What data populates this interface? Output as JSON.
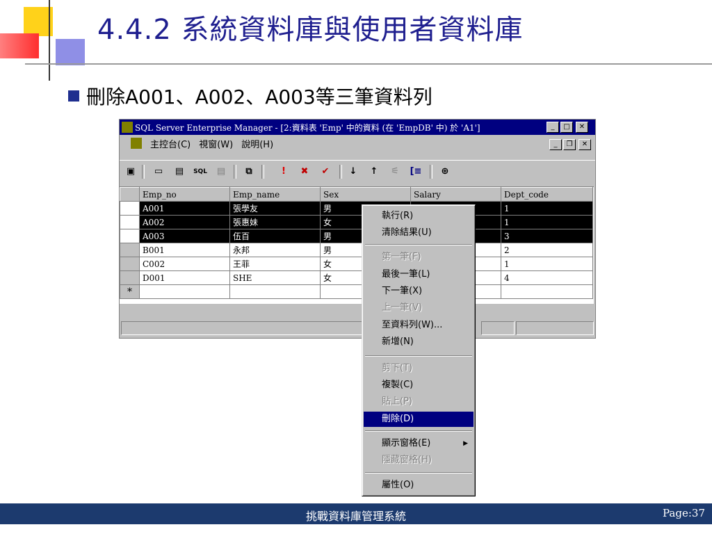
{
  "slide": {
    "title": "4.4.2 系統資料庫與使用者資料庫",
    "bullet": "刪除A001、A002、A003等三筆資料列"
  },
  "window": {
    "title": "SQL Server Enterprise Manager - [2:資料表 'Emp' 中的資料 (在 'EmpDB' 中) 於 'A1']",
    "menu": [
      "主控台(C)",
      "視窗(W)",
      "說明(H)"
    ],
    "grid": {
      "columns": [
        "Emp_no",
        "Emp_name",
        "Sex",
        "Salary",
        "Dept_code"
      ],
      "rows": [
        {
          "emp_no": "A001",
          "emp_name": "張學友",
          "sex": "男",
          "salary": "",
          "dept_code": "1",
          "selected": true
        },
        {
          "emp_no": "A002",
          "emp_name": "張惠妹",
          "sex": "女",
          "salary": "",
          "dept_code": "1",
          "selected": true
        },
        {
          "emp_no": "A003",
          "emp_name": "伍百",
          "sex": "男",
          "salary": "",
          "dept_code": "3",
          "selected": true
        },
        {
          "emp_no": "B001",
          "emp_name": "永邦",
          "sex": "男",
          "salary": "",
          "dept_code": "2",
          "selected": false
        },
        {
          "emp_no": "C002",
          "emp_name": "王菲",
          "sex": "女",
          "salary": "",
          "dept_code": "1",
          "selected": false
        },
        {
          "emp_no": "D001",
          "emp_name": "SHE",
          "sex": "女",
          "salary": "",
          "dept_code": "4",
          "selected": false
        }
      ],
      "new_row_marker": "*"
    }
  },
  "context_menu": {
    "items": [
      {
        "label": "執行(R)",
        "state": "enabled"
      },
      {
        "label": "清除結果(U)",
        "state": "enabled"
      },
      {
        "label": "第一筆(F)",
        "state": "disabled"
      },
      {
        "label": "最後一筆(L)",
        "state": "enabled"
      },
      {
        "label": "下一筆(X)",
        "state": "enabled"
      },
      {
        "label": "上一筆(V)",
        "state": "disabled"
      },
      {
        "label": "至資料列(W)...",
        "state": "enabled"
      },
      {
        "label": "新增(N)",
        "state": "enabled"
      },
      {
        "label": "剪下(T)",
        "state": "disabled"
      },
      {
        "label": "複製(C)",
        "state": "enabled"
      },
      {
        "label": "貼上(P)",
        "state": "disabled"
      },
      {
        "label": "刪除(D)",
        "state": "highlighted"
      },
      {
        "label": "顯示窗格(E)",
        "state": "enabled",
        "submenu": true
      },
      {
        "label": "隱藏窗格(H)",
        "state": "disabled"
      },
      {
        "label": "屬性(O)",
        "state": "enabled"
      }
    ]
  },
  "footer": {
    "center": "挑戰資料庫管理系統",
    "page": "Page:37"
  },
  "colors": {
    "title": "#1f1f8f",
    "footer_bg": "#1c3a6e",
    "titlebar": "#000080",
    "highlight": "#000080"
  }
}
